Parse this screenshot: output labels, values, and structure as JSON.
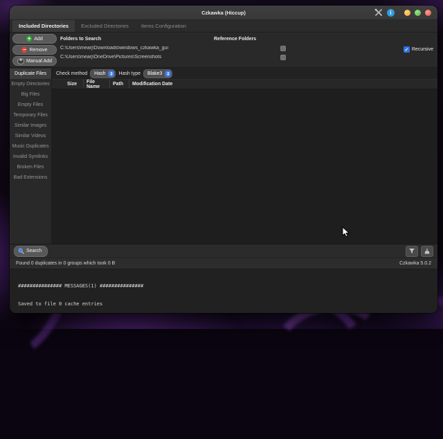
{
  "window": {
    "title": "Czkawka (Hiccup)"
  },
  "glyphs": {
    "plus": "+",
    "minus": "−",
    "check": "✓",
    "info": "i"
  },
  "tabs": [
    {
      "label": "Included Directories",
      "active": true
    },
    {
      "label": "Excluded Directories",
      "active": false
    },
    {
      "label": "Items Configuration",
      "active": false
    }
  ],
  "directories_panel": {
    "buttons": {
      "add": "Add",
      "remove": "Remove",
      "manual_add": "Manual Add"
    },
    "columns": {
      "folders": "Folders to Search",
      "reference": "Reference Folders"
    },
    "rows": [
      {
        "path": "C:\\Users\\mearj\\Downloads\\windows_czkawka_gui",
        "reference_checked": false
      },
      {
        "path": "C:\\Users\\mearj\\OneDrive\\Pictures\\Screenshots",
        "reference_checked": false
      }
    ],
    "recursive": {
      "label": "Recursive",
      "checked": true
    }
  },
  "sidebar": {
    "items": [
      {
        "label": "Duplicate Files",
        "active": true
      },
      {
        "label": "Empty Directories",
        "active": false
      },
      {
        "label": "Big Files",
        "active": false
      },
      {
        "label": "Empty Files",
        "active": false
      },
      {
        "label": "Temporary Files",
        "active": false
      },
      {
        "label": "Similar Images",
        "active": false
      },
      {
        "label": "Similar Videos",
        "active": false
      },
      {
        "label": "Music Duplicates",
        "active": false
      },
      {
        "label": "Invalid Symlinks",
        "active": false
      },
      {
        "label": "Broken Files",
        "active": false
      },
      {
        "label": "Bad Extensions",
        "active": false
      }
    ]
  },
  "options": {
    "check_method_label": "Check method",
    "check_method_value": "Hash",
    "hash_type_label": "Hash type",
    "hash_type_value": "Blake3"
  },
  "results_table": {
    "columns": [
      "Size",
      "File Name",
      "Path",
      "Modification Date"
    ]
  },
  "bottom": {
    "search_label": "Search"
  },
  "statusbar": {
    "message": "Found 0 duplicates in 0 groups which took 0 B",
    "version": "Czkawka 5.0.2"
  },
  "log": {
    "lines": [
      "############### MESSAGES(1) ###############",
      "Saved to file 0 cache entries"
    ]
  },
  "icons": {
    "tools": "crossed-wrench-and-screwdriver",
    "info": "info-circle-blue",
    "minimize": "yellow-traffic-dot",
    "maximize": "green-traffic-dot",
    "close": "red-traffic-dot",
    "add": "green-plus-circle",
    "remove": "red-minus-circle",
    "manual_add": "outlined-plus-circle",
    "dropdown": "blue-up-down-chevrons",
    "search": "blue-magnifier",
    "sort": "funnel",
    "clean": "broom"
  },
  "colors": {
    "accent_blue": "#3e78e7",
    "checkbox_blue": "#3273e0",
    "info_blue": "#2f9fe0",
    "traffic_yellow": "#eda93a",
    "traffic_green": "#58bb45",
    "traffic_red": "#e5544a",
    "add_green": "#2fae35",
    "remove_red": "#df4438",
    "titlebar_bg": "#3a3a3a",
    "panel_bg": "#292929",
    "table_bg": "#1e1e1e"
  }
}
